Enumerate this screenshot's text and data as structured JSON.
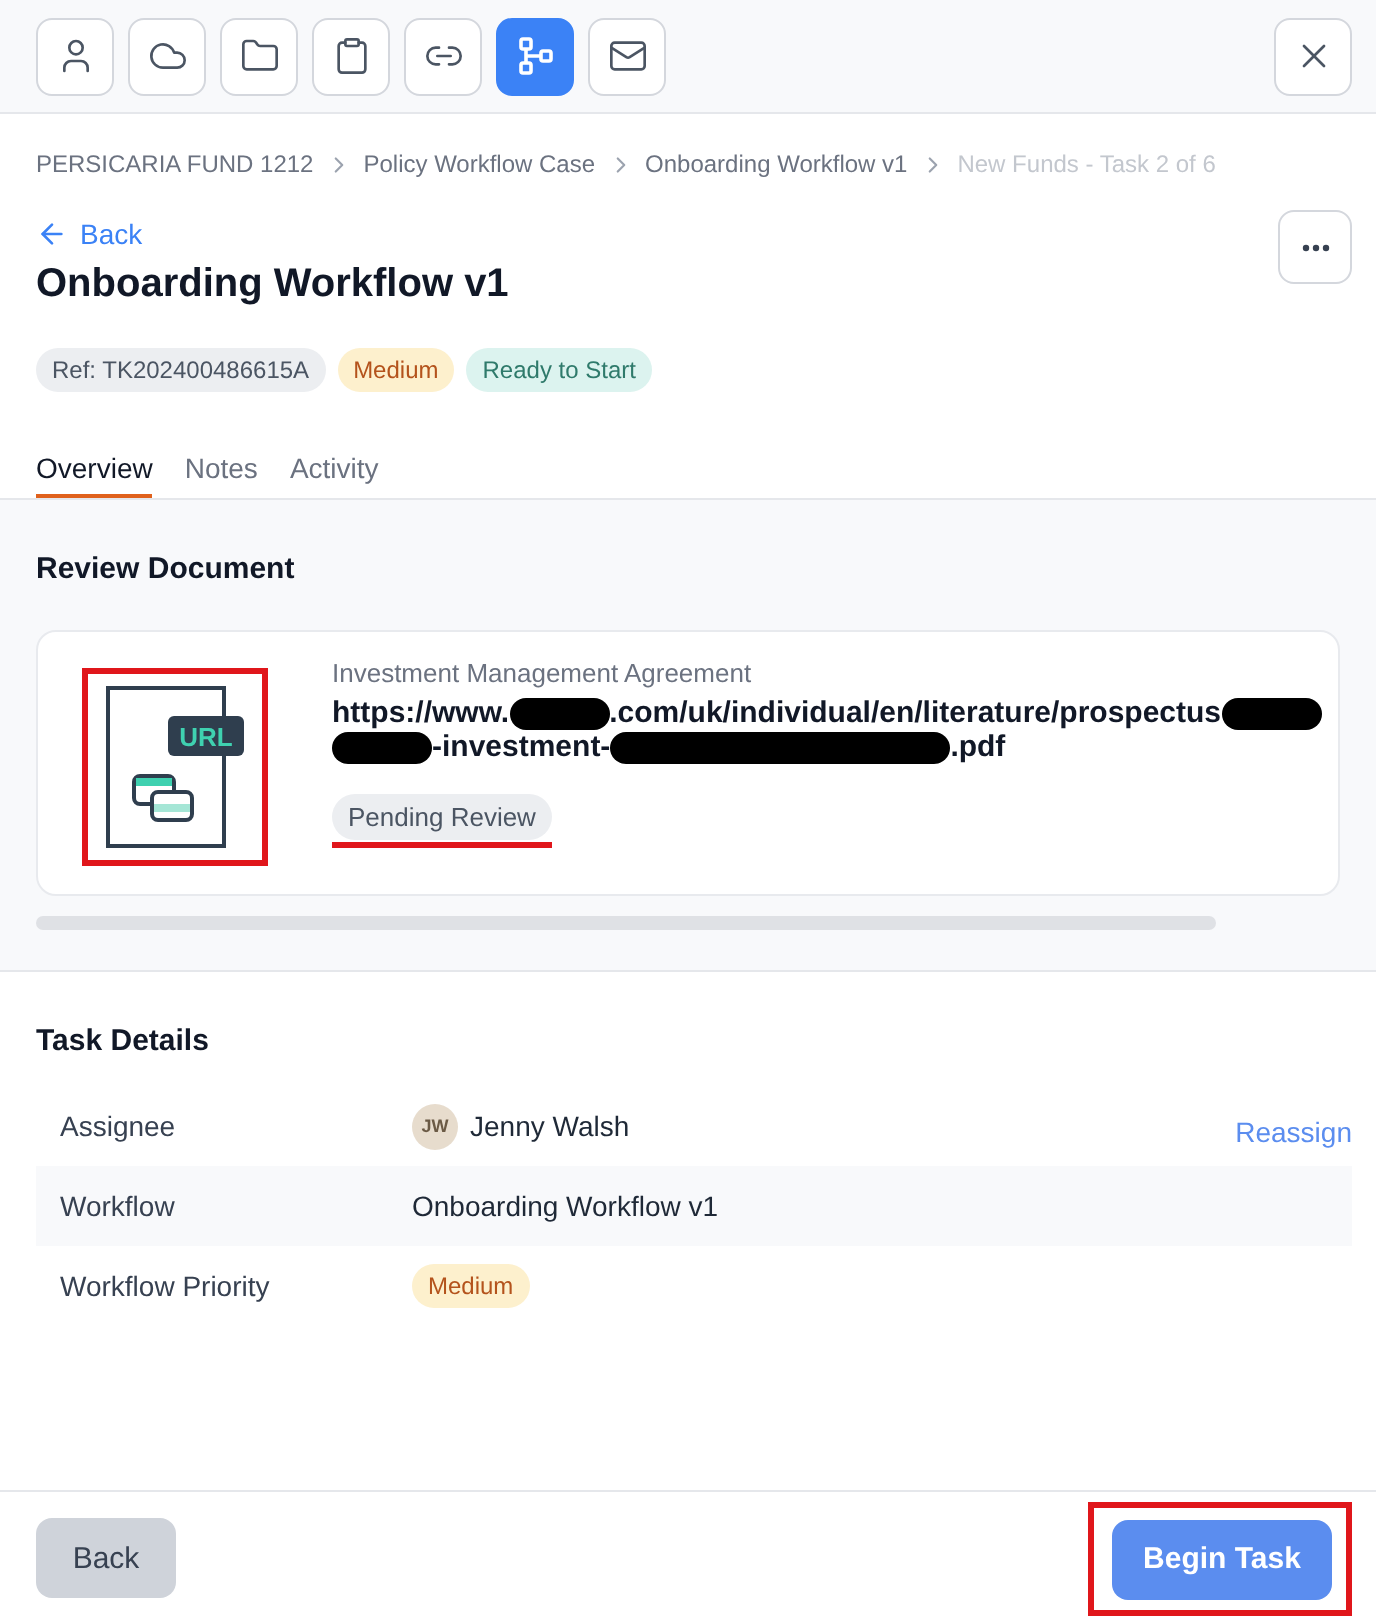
{
  "toolbar": {
    "buttons": [
      {
        "kind": "user",
        "selected": false
      },
      {
        "kind": "cloud",
        "selected": false
      },
      {
        "kind": "folder",
        "selected": false
      },
      {
        "kind": "clipboard",
        "selected": false
      },
      {
        "kind": "link",
        "selected": false
      },
      {
        "kind": "workflow",
        "selected": true
      },
      {
        "kind": "mail",
        "selected": false
      }
    ]
  },
  "breadcrumb": [
    {
      "label": "PERSICARIA FUND 1212",
      "current": false
    },
    {
      "label": "Policy Workflow Case",
      "current": false
    },
    {
      "label": "Onboarding Workflow v1",
      "current": false
    },
    {
      "label": "New Funds - Task 2 of 6",
      "current": true
    }
  ],
  "back_link": "Back",
  "title": "Onboarding Workflow v1",
  "badges": [
    {
      "kind": "ref",
      "label": "Ref: TK202400486615A"
    },
    {
      "kind": "priority",
      "label": "Medium"
    },
    {
      "kind": "status",
      "label": "Ready to Start"
    }
  ],
  "tabs": [
    {
      "label": "Overview",
      "selected": true
    },
    {
      "label": "Notes",
      "selected": false
    },
    {
      "label": "Activity",
      "selected": false
    }
  ],
  "review": {
    "heading": "Review Document",
    "document": {
      "icon_label": "URL",
      "icon_highlighted": true,
      "name": "Investment Management Agreement",
      "url_parts": [
        {
          "kind": "text",
          "text": "https://www."
        },
        {
          "kind": "redacted"
        },
        {
          "kind": "text",
          "text": ".com/uk/individual/en/literature/prospectus"
        },
        {
          "kind": "redacted"
        },
        {
          "kind": "redacted"
        },
        {
          "kind": "text",
          "text": "-investment-"
        },
        {
          "kind": "redacted_long"
        },
        {
          "kind": "text",
          "text": ".pdf"
        }
      ],
      "status": "Pending Review",
      "status_underlined": true
    }
  },
  "task_details": {
    "heading": "Task Details",
    "rows": [
      {
        "kind": "person",
        "label": "Assignee",
        "initials": "JW",
        "value": "Jenny Walsh",
        "action": "Reassign"
      },
      {
        "kind": "text",
        "label": "Workflow",
        "value": "Onboarding Workflow v1"
      },
      {
        "kind": "badge",
        "label": "Workflow Priority",
        "value": "Medium"
      }
    ]
  },
  "footer": {
    "back_button": "Back",
    "primary_button": "Begin Task",
    "primary_highlighted": true
  }
}
